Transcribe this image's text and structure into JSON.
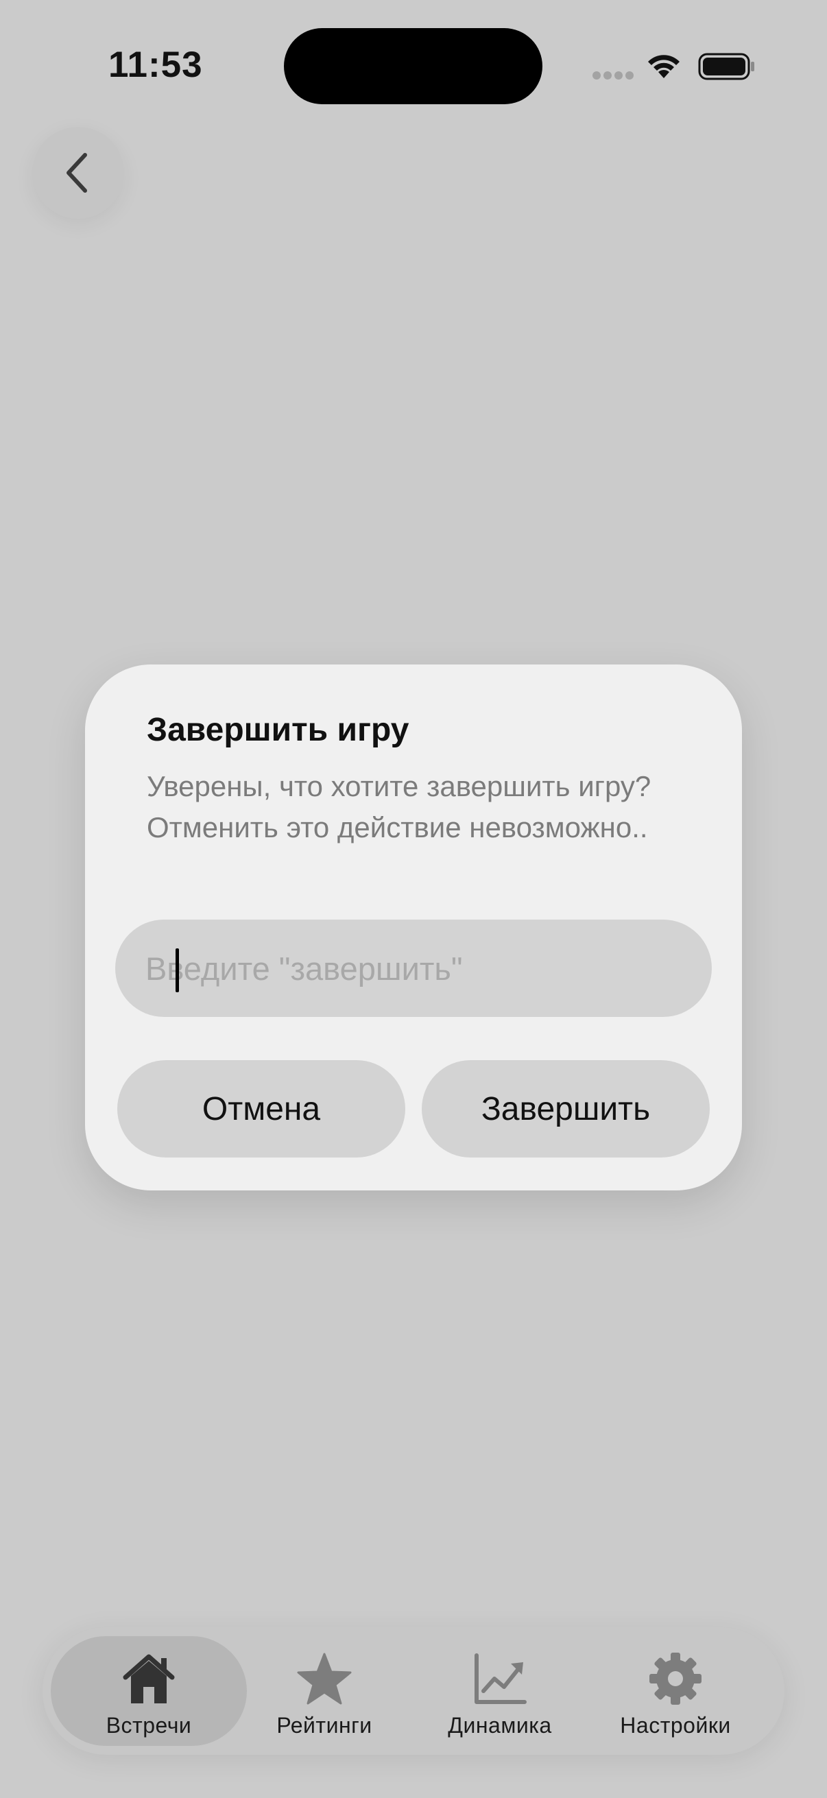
{
  "status_bar": {
    "time": "11:53"
  },
  "back_button": {
    "icon": "chevron-left-icon"
  },
  "dialog": {
    "title": "Завершить игру",
    "message": "Уверены, что хотите завершить игру? Отменить это действие невозможно..",
    "input": {
      "value": "",
      "placeholder": "Введите \"завершить\""
    },
    "cancel_label": "Отмена",
    "confirm_label": "Завершить"
  },
  "tab_bar": {
    "active_index": 0,
    "tabs": [
      {
        "label": "Встречи",
        "icon": "house-icon"
      },
      {
        "label": "Рейтинги",
        "icon": "star-icon"
      },
      {
        "label": "Динамика",
        "icon": "chart-line-icon"
      },
      {
        "label": "Настройки",
        "icon": "gear-icon"
      }
    ]
  },
  "colors": {
    "background": "#cbcbcb",
    "dialog": "#f0f0f0",
    "field": "#d3d3d3",
    "tab_active": "#b6b6b6",
    "icon_active": "#333333",
    "icon_inactive": "#7d7d7d"
  }
}
